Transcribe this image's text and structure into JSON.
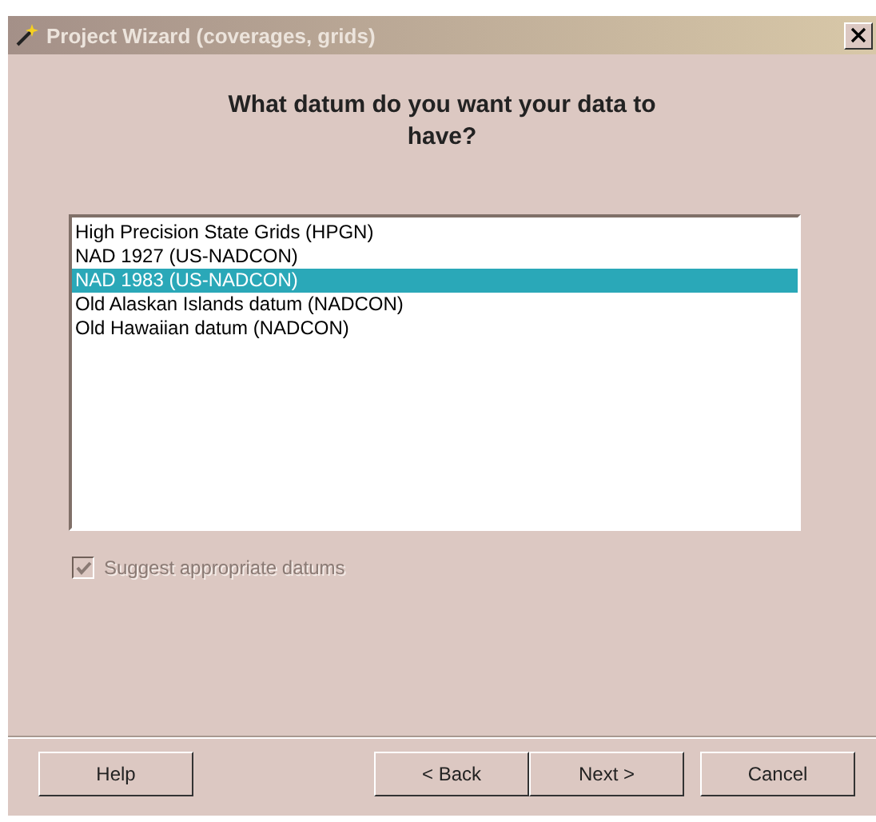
{
  "window": {
    "title": "Project Wizard (coverages, grids)"
  },
  "heading": "What datum do you want your data to have?",
  "datums": [
    {
      "label": "High Precision State Grids (HPGN)",
      "selected": false
    },
    {
      "label": "NAD 1927 (US-NADCON)",
      "selected": false
    },
    {
      "label": "NAD 1983 (US-NADCON)",
      "selected": true
    },
    {
      "label": "Old Alaskan Islands datum (NADCON)",
      "selected": false
    },
    {
      "label": "Old Hawaiian datum (NADCON)",
      "selected": false
    }
  ],
  "suggest": {
    "label": "Suggest appropriate datums",
    "checked": true,
    "disabled": true
  },
  "buttons": {
    "help": "Help",
    "back": "< Back",
    "next": "Next >",
    "cancel": "Cancel"
  }
}
